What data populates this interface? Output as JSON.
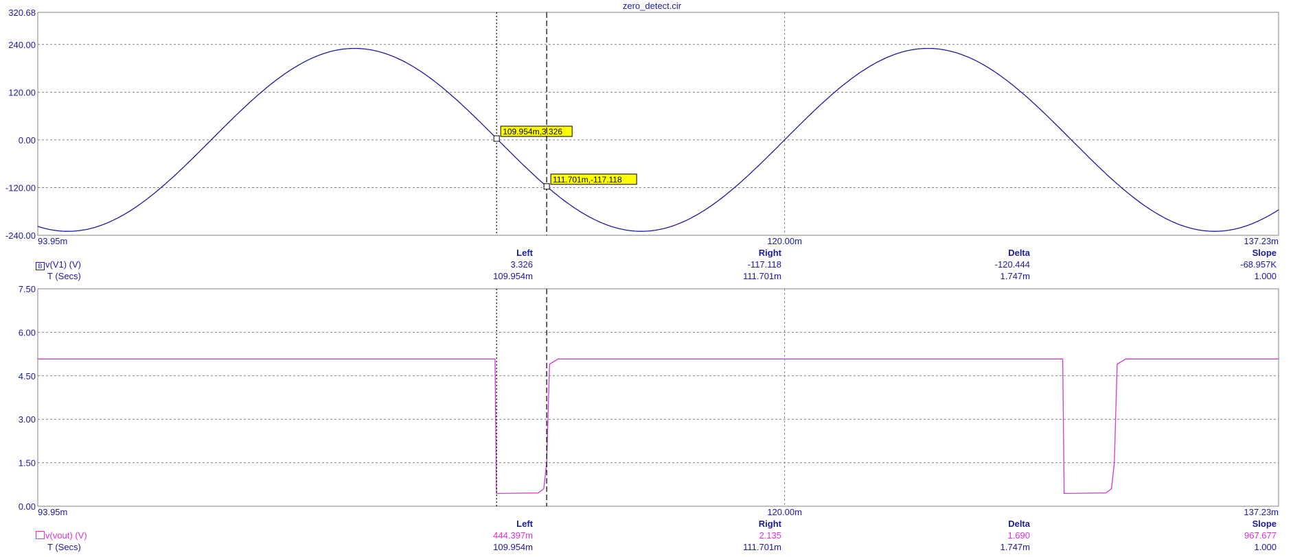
{
  "title": "zero_detect.cir",
  "colors": {
    "axis_text": "#1a1aa0",
    "trace1": "#1a1aa0",
    "trace2": "#d633d6",
    "grid": "#808080",
    "cursor_label_bg": "#ffff00"
  },
  "chart_data": [
    {
      "type": "line",
      "series": [
        {
          "name": "v(V1) (V)",
          "function": "sine",
          "amplitude": 230,
          "offset": 0,
          "frequency_hz": 50,
          "zero_cross_down_at_s": 0.11
        }
      ],
      "x_unit": "s",
      "ylim": [
        -240,
        320.68
      ],
      "xlim": [
        0.09395,
        0.13723
      ],
      "y_tick_labels": [
        "320.68",
        "240.00",
        "120.00",
        "0.00",
        "-120.00",
        "-240.00"
      ],
      "y_tick_values": [
        320.68,
        240,
        120,
        0,
        -120,
        -240
      ],
      "x_tick_labels": [
        "93.95m",
        "120.00m",
        "137.23m"
      ],
      "x_tick_values": [
        0.09395,
        0.12,
        0.13723
      ],
      "grid": true,
      "cursors": [
        {
          "x": 0.109954,
          "y": 3.326,
          "label": "109.954m,3.326",
          "style": "dotted"
        },
        {
          "x": 0.111701,
          "y": -117.118,
          "label": "111.701m,-117.118",
          "style": "dashed"
        }
      ],
      "readout": {
        "headers": [
          "Left",
          "Right",
          "Delta",
          "Slope"
        ],
        "trace_label": "v(V1) (V)",
        "trace_marker": "B",
        "trace_values": [
          "3.326",
          "-117.118",
          "-120.444",
          "-68.957K"
        ],
        "x_label": "T (Secs)",
        "x_values": [
          "109.954m",
          "111.701m",
          "1.747m",
          "1.000"
        ]
      }
    },
    {
      "type": "line",
      "series": [
        {
          "name": "v(vout) (V)",
          "points": [
            [
              0.09395,
              5.08
            ],
            [
              0.1099,
              5.08
            ],
            [
              0.10995,
              0.44
            ],
            [
              0.1114,
              0.46
            ],
            [
              0.1116,
              0.6
            ],
            [
              0.1117,
              1.5
            ],
            [
              0.1118,
              4.9
            ],
            [
              0.1121,
              5.08
            ],
            [
              0.1297,
              5.08
            ],
            [
              0.12975,
              0.44
            ],
            [
              0.1312,
              0.46
            ],
            [
              0.1314,
              0.6
            ],
            [
              0.1315,
              1.5
            ],
            [
              0.1316,
              4.9
            ],
            [
              0.1319,
              5.08
            ],
            [
              0.13723,
              5.08
            ]
          ]
        }
      ],
      "x_unit": "s",
      "ylim": [
        0,
        7.5
      ],
      "xlim": [
        0.09395,
        0.13723
      ],
      "y_tick_labels": [
        "7.50",
        "6.00",
        "4.50",
        "3.00",
        "1.50",
        "0.00"
      ],
      "y_tick_values": [
        7.5,
        6,
        4.5,
        3,
        1.5,
        0
      ],
      "x_tick_labels": [
        "93.95m",
        "120.00m",
        "137.23m"
      ],
      "x_tick_values": [
        0.09395,
        0.12,
        0.13723
      ],
      "grid": true,
      "cursors": [
        {
          "x": 0.109954,
          "style": "dotted"
        },
        {
          "x": 0.111701,
          "style": "dashed"
        }
      ],
      "readout": {
        "headers": [
          "Left",
          "Right",
          "Delta",
          "Slope"
        ],
        "trace_label": "v(vout) (V)",
        "trace_values": [
          "444.397m",
          "2.135",
          "1.690",
          "967.677"
        ],
        "x_label": "T (Secs)",
        "x_values": [
          "109.954m",
          "111.701m",
          "1.747m",
          "1.000"
        ]
      }
    }
  ]
}
